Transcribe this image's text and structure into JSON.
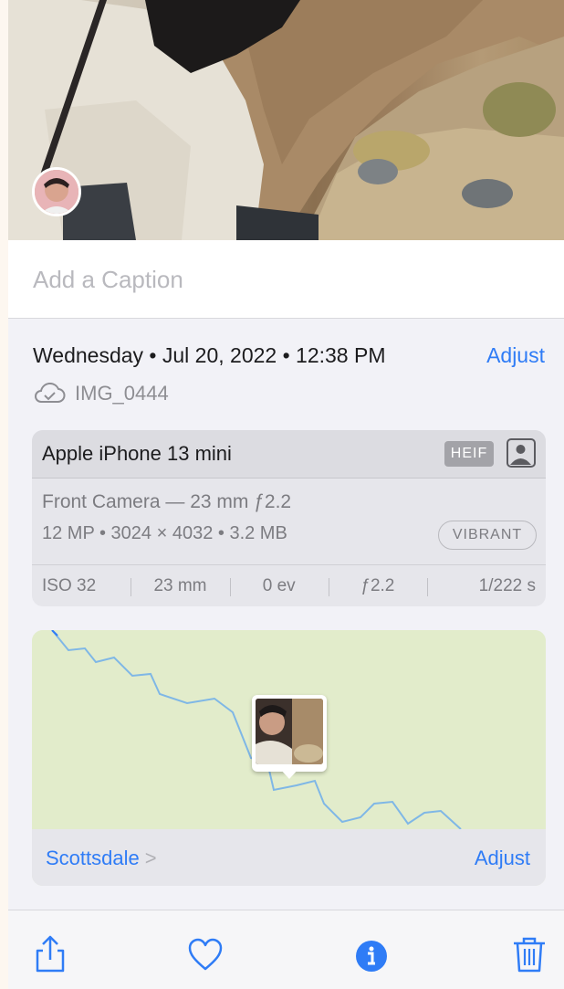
{
  "caption": {
    "placeholder": "Add a Caption"
  },
  "info": {
    "date": "Wednesday • Jul 20, 2022 • 12:38 PM",
    "adjust_label": "Adjust",
    "filename": "IMG_0444"
  },
  "camera": {
    "model": "Apple iPhone 13 mini",
    "format_badge": "HEIF",
    "lens": "Front Camera — 23 mm ƒ2.2",
    "specs": "12 MP  •  3024 × 4032  •  3.2 MB",
    "style_badge": "VIBRANT",
    "exif": [
      "ISO 32",
      "23 mm",
      "0 ev",
      "ƒ2.2",
      "1/222 s"
    ]
  },
  "map": {
    "place": "Scottsdale",
    "adjust_label": "Adjust"
  },
  "toolbar": {
    "share": "share-icon",
    "favorite": "heart-icon",
    "info": "info-icon",
    "delete": "trash-icon"
  },
  "colors": {
    "accent": "#2f7cf6",
    "map_land": "#e2eccb",
    "map_water": "#7fb7e6"
  }
}
